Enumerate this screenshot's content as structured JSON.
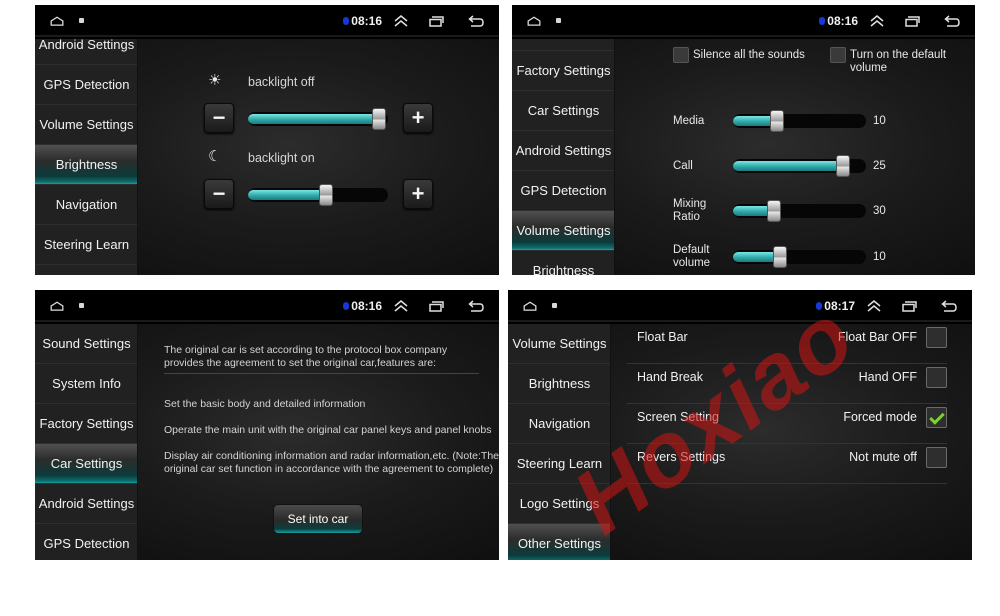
{
  "status_bar": [
    {
      "time": "08:16"
    },
    {
      "time": "08:16"
    },
    {
      "time": "08:16"
    },
    {
      "time": "08:17"
    }
  ],
  "icons": {
    "home": "home-icon",
    "sim": "sim-icon",
    "bluetooth": "bluetooth-icon",
    "collapse": "double-chevron-up-icon",
    "recent": "recent-apps-icon",
    "back": "back-icon"
  },
  "brightness_panel": {
    "sidebar": [
      "Android Settings",
      "GPS Detection",
      "Volume Settings",
      "Brightness",
      "Navigation",
      "Steering Learn"
    ],
    "active": "Brightness",
    "sliders": [
      {
        "icon": "☀",
        "label": "backlight off",
        "value_fraction": 0.96
      },
      {
        "icon": "☾",
        "label": "backlight on",
        "value_fraction": 0.58
      }
    ],
    "minus": "−",
    "plus": "+"
  },
  "volume_panel": {
    "sidebar": [
      "",
      "Factory Settings",
      "Car Settings",
      "Android Settings",
      "GPS Detection",
      "Volume Settings",
      "Brightness"
    ],
    "active": "Volume Settings",
    "checkboxes": [
      {
        "label": "Silence all the sounds",
        "checked": false
      },
      {
        "label": "Turn on the default volume",
        "checked": false
      }
    ],
    "sliders": [
      {
        "label": "Media",
        "value": "10",
        "value_fraction": 0.33
      },
      {
        "label": "Call",
        "value": "25",
        "value_fraction": 0.83
      },
      {
        "label": "Mixing Ratio",
        "value": "30",
        "value_fraction": 0.31
      },
      {
        "label": "Default volume",
        "value": "10",
        "value_fraction": 0.35
      }
    ]
  },
  "car_panel": {
    "sidebar": [
      "Sound Settings",
      "System Info",
      "Factory Settings",
      "Car Settings",
      "Android Settings",
      "GPS Detection"
    ],
    "active": "Car Settings",
    "intro": "The original car is set according to the protocol box company provides the agreement to set the original car,features are:",
    "features": [
      "Set the basic body and detailed information",
      "Operate the main unit with the original car panel keys and panel knobs",
      "Display air conditioning information and radar information,etc. (Note:The original car set function in accordance with the agreement to complete)"
    ],
    "button": "Set into car"
  },
  "other_panel": {
    "sidebar": [
      "Volume Settings",
      "Brightness",
      "Navigation",
      "Steering Learn",
      "Logo Settings",
      "Other Settings"
    ],
    "active": "Other Settings",
    "rows": [
      {
        "name": "Float Bar",
        "state": "Float Bar OFF",
        "checked": false
      },
      {
        "name": "Hand Break",
        "state": "Hand OFF",
        "checked": false
      },
      {
        "name": "Screen Setting",
        "state": "Forced mode",
        "checked": true
      },
      {
        "name": "Revers Settings",
        "state": "Not mute off",
        "checked": false
      }
    ]
  },
  "watermark": "Hoxiao",
  "colors": {
    "accent": "#16a3a3",
    "check": "#7ad22a",
    "bluetooth": "#1837d8",
    "watermark": "#d21414"
  }
}
